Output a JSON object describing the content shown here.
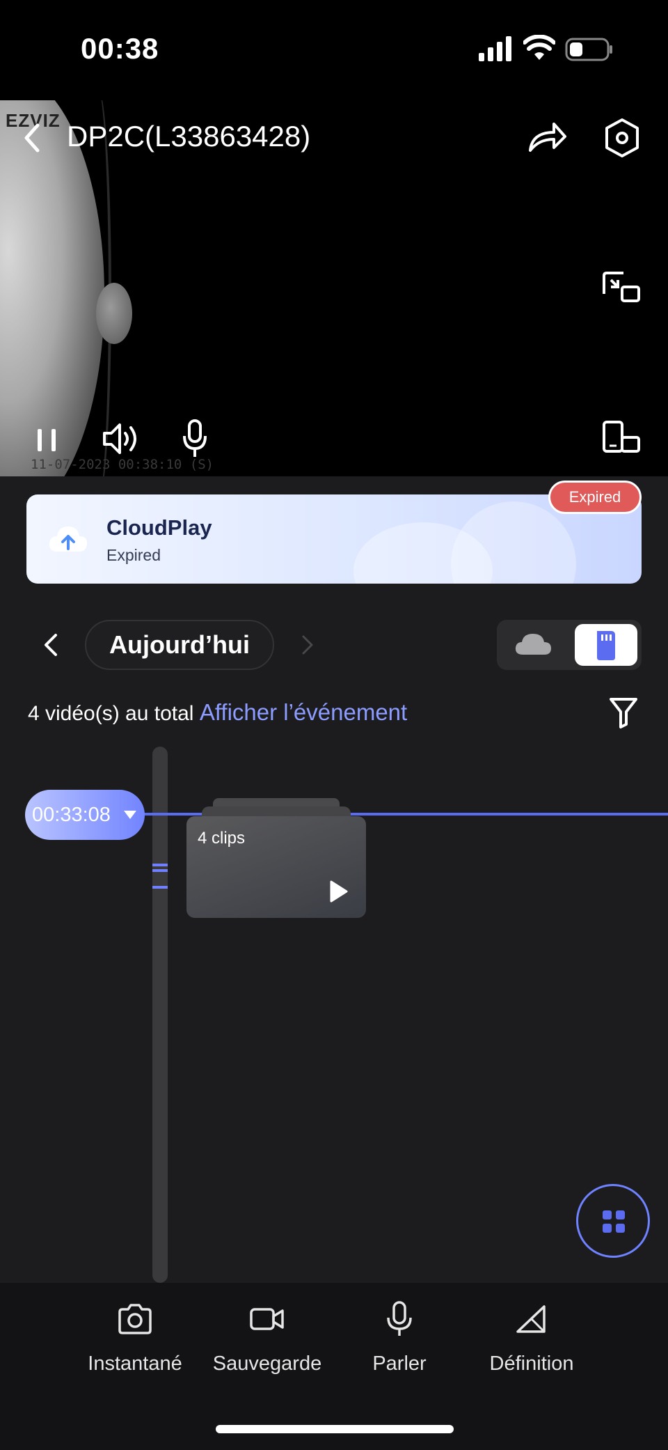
{
  "status_bar": {
    "time": "00:38"
  },
  "player": {
    "title": "DP2C(L33863428)",
    "watermark": "EZVIZ",
    "osd_timestamp": "11-07-2023 00:38:10  (S)"
  },
  "cloud_banner": {
    "title": "CloudPlay",
    "subtitle": "Expired",
    "badge": "Expired"
  },
  "date_nav": {
    "label": "Aujourd’hui"
  },
  "summary": {
    "count_text": "4 vidéo(s) au total",
    "link": "Afficher l’événement"
  },
  "timeline": {
    "current_time": "00:33:08",
    "clip_group_label": "4 clips"
  },
  "toolbar": {
    "items": [
      {
        "label": "Instantané",
        "icon": "camera-icon"
      },
      {
        "label": "Sauvegarde",
        "icon": "video-record-icon"
      },
      {
        "label": "Parler",
        "icon": "microphone-icon"
      },
      {
        "label": "Définition",
        "icon": "definition-icon"
      }
    ]
  },
  "colors": {
    "accent": "#7284ff",
    "link": "#8c9cff",
    "expired": "#e05a5a",
    "background": "#1c1c1e"
  }
}
